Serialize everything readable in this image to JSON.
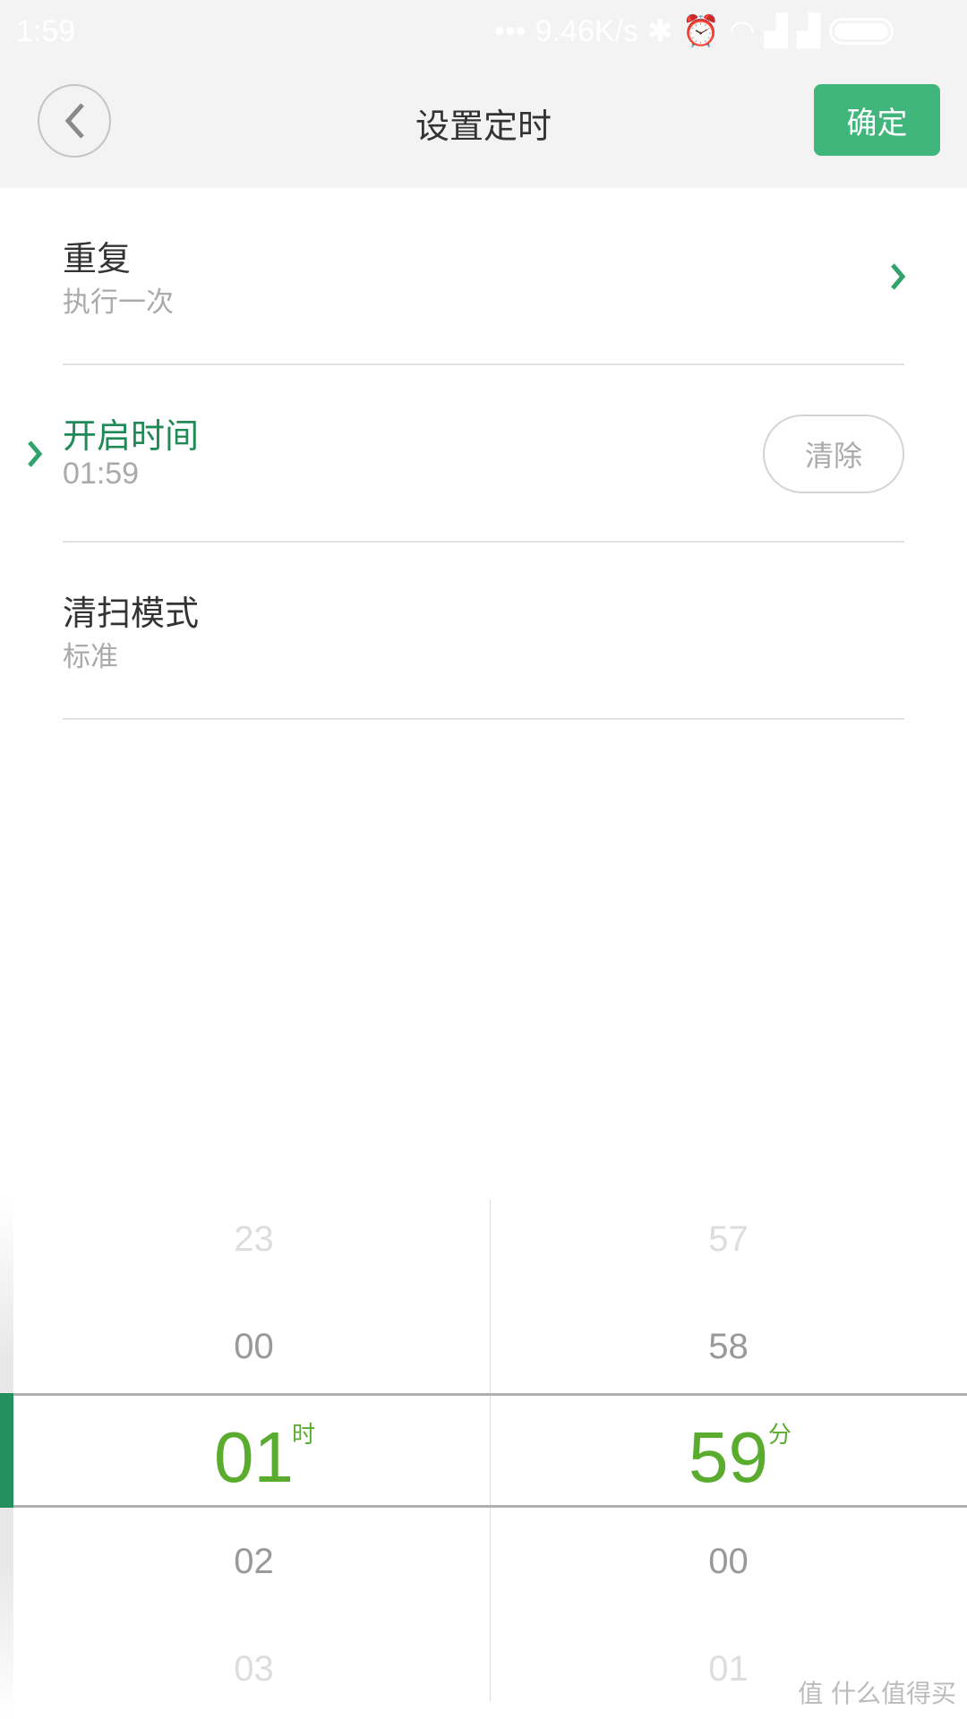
{
  "status_bar": {
    "time": "1:59",
    "net_speed": "9.46K/s",
    "icons": [
      "dots-icon",
      "bluetooth-icon",
      "alarm-icon",
      "wifi-icon",
      "signal-icon",
      "signal-icon",
      "battery-icon"
    ]
  },
  "header": {
    "title": "设置定时",
    "confirm_label": "确定",
    "back_icon": "chevron-left-icon"
  },
  "rows": [
    {
      "label": "重复",
      "value": "执行一次"
    },
    {
      "label": "开启时间",
      "value": "01:59",
      "action": "清除"
    },
    {
      "label": "清扫模式",
      "value": "标准"
    }
  ],
  "picker": {
    "hours": [
      "23",
      "00",
      "01",
      "02",
      "03"
    ],
    "minutes": [
      "57",
      "58",
      "59",
      "00",
      "01"
    ],
    "selected_hour": "01",
    "selected_minute": "59",
    "hour_unit": "时",
    "minute_unit": "分"
  },
  "watermark": "值 什么值得买",
  "colors": {
    "accent": "#40b67c",
    "active_label": "#1f8a55",
    "selected_value": "#5aac2e"
  }
}
